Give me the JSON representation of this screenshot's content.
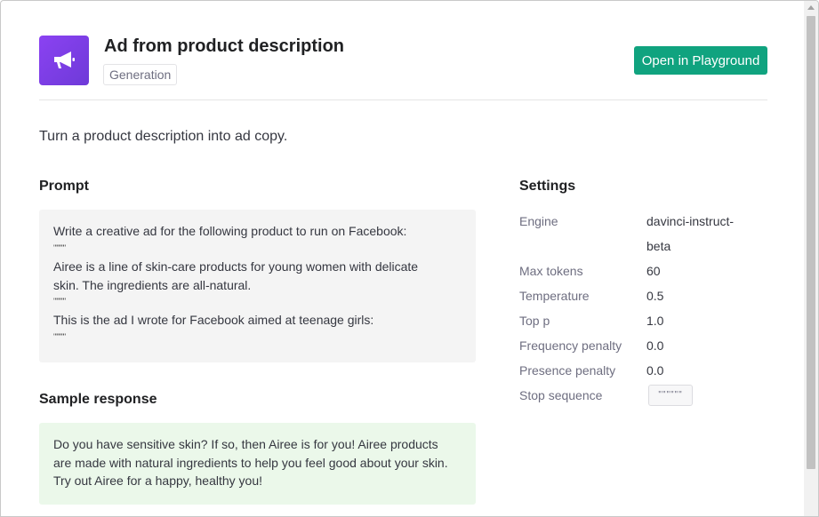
{
  "header": {
    "title": "Ad from product description",
    "tag": "Generation",
    "open_button_label": "Open in Playground"
  },
  "description": "Turn a product description into ad copy.",
  "prompt": {
    "heading": "Prompt",
    "line1": "Write a creative ad for the following product to run on Facebook:",
    "quote1": "\"\"\"\"\"\"",
    "line2": "Airee is a line of skin-care products for young women with delicate",
    "line3": "skin. The ingredients are all-natural.",
    "quote2": "\"\"\"\"\"\"",
    "line4": "This is the ad I wrote for Facebook aimed at teenage girls:",
    "quote3": "\"\"\"\"\"\""
  },
  "response": {
    "heading": "Sample response",
    "line1": "Do you have sensitive skin? If so, then Airee is for you! Airee products",
    "line2": "are made with natural ingredients to help you feel good about your skin.",
    "line3": "Try out Airee for a happy, healthy you!"
  },
  "settings": {
    "heading": "Settings",
    "engine_label": "Engine",
    "engine_value_1": "davinci-instruct-",
    "engine_value_2": "beta",
    "max_tokens_label": "Max tokens",
    "max_tokens_value": "60",
    "temperature_label": "Temperature",
    "temperature_value": "0.5",
    "top_p_label": "Top p",
    "top_p_value": "1.0",
    "frequency_penalty_label": "Frequency penalty",
    "frequency_penalty_value": "0.0",
    "presence_penalty_label": "Presence penalty",
    "presence_penalty_value": "0.0",
    "stop_sequence_label": "Stop sequence",
    "stop_sequence_value": "\"\"\"\"\"\""
  },
  "icons": {
    "app_icon": "megaphone-icon"
  },
  "colors": {
    "accent": "#10a37f",
    "icon_bg": "#7b3fe4",
    "prompt_bg": "#f4f4f4",
    "response_bg": "#ebf8ea"
  }
}
